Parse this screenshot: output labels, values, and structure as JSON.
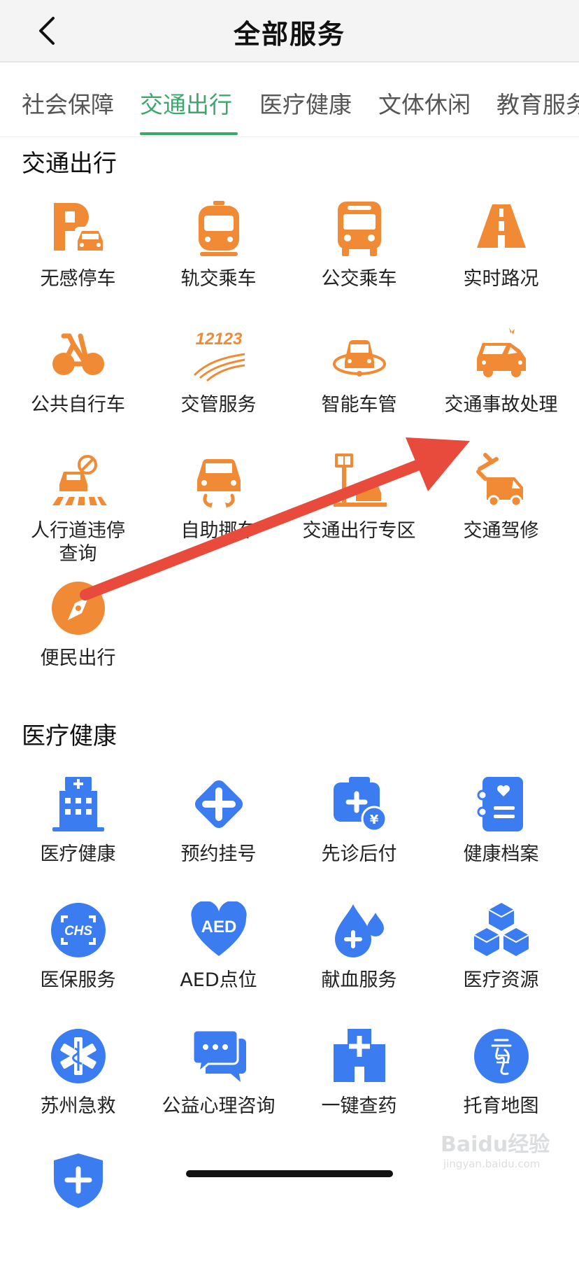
{
  "header": {
    "title": "全部服务"
  },
  "tabs": [
    {
      "label": "社会保障"
    },
    {
      "label": "交通出行"
    },
    {
      "label": "医疗健康"
    },
    {
      "label": "文体休闲"
    },
    {
      "label": "教育服务"
    }
  ],
  "active_tab": "交通出行",
  "sections": {
    "transport": {
      "title": "交通出行",
      "items": [
        {
          "label": "无感停车",
          "icon": "parking-car-icon"
        },
        {
          "label": "轨交乘车",
          "icon": "metro-train-icon"
        },
        {
          "label": "公交乘车",
          "icon": "bus-icon"
        },
        {
          "label": "实时路况",
          "icon": "road-icon"
        },
        {
          "label": "公共自行车",
          "icon": "bicycle-icon"
        },
        {
          "label": "交管服务",
          "icon": "traffic-12123-icon",
          "badge_text": "12123"
        },
        {
          "label": "智能车管",
          "icon": "smart-car-icon"
        },
        {
          "label": "交通事故处理",
          "icon": "car-accident-icon"
        },
        {
          "label": "人行道违停\n查询",
          "icon": "no-parking-crosswalk-icon"
        },
        {
          "label": "自助挪车",
          "icon": "move-car-icon"
        },
        {
          "label": "交通出行专区",
          "icon": "transport-zone-icon"
        },
        {
          "label": "交通驾修",
          "icon": "repair-truck-icon"
        },
        {
          "label": "便民出行",
          "icon": "compass-icon"
        }
      ]
    },
    "medical": {
      "title": "医疗健康",
      "items": [
        {
          "label": "医疗健康",
          "icon": "hospital-building-icon"
        },
        {
          "label": "预约挂号",
          "icon": "plus-diamond-icon"
        },
        {
          "label": "先诊后付",
          "icon": "medical-kit-yuan-icon"
        },
        {
          "label": "健康档案",
          "icon": "health-record-icon"
        },
        {
          "label": "医保服务",
          "icon": "chs-insurance-icon",
          "badge_text": "CHS"
        },
        {
          "label": "AED点位",
          "icon": "aed-heart-icon",
          "badge_text": "AED"
        },
        {
          "label": "献血服务",
          "icon": "blood-drop-icon"
        },
        {
          "label": "医疗资源",
          "icon": "cubes-icon"
        },
        {
          "label": "苏州急救",
          "icon": "star-of-life-icon"
        },
        {
          "label": "公益心理咨询",
          "icon": "chat-bubbles-icon"
        },
        {
          "label": "一键查药",
          "icon": "hospital-cross-icon"
        },
        {
          "label": "托育地图",
          "icon": "childcare-map-icon"
        },
        {
          "label": "",
          "icon": "shield-plus-icon"
        }
      ]
    }
  },
  "watermark": {
    "text": "Baidu经验",
    "sub": "jingyan.baidu.com"
  },
  "colors": {
    "orange": "#f08a35",
    "blue": "#3b7df0",
    "green": "#3aa86b",
    "arrow": "#e84b3c"
  }
}
